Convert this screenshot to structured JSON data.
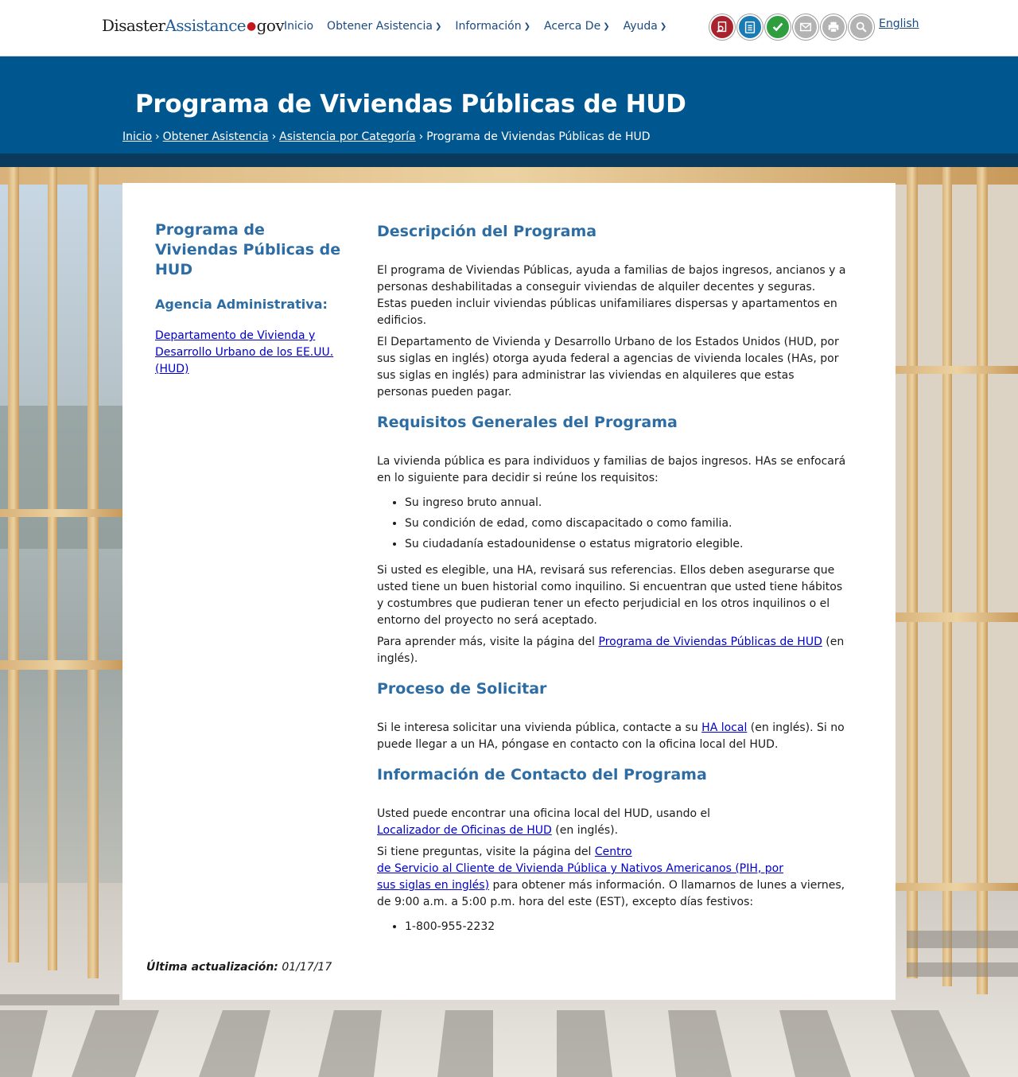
{
  "header": {
    "logo": {
      "part1": "Disaster",
      "part2": "Assistance",
      "dot": "●",
      "part3": "gov"
    },
    "nav": [
      {
        "label": "Inicio",
        "has_dropdown": false
      },
      {
        "label": "Obtener Asistencia",
        "has_dropdown": true
      },
      {
        "label": "Información",
        "has_dropdown": true
      },
      {
        "label": "Acerca De",
        "has_dropdown": true
      },
      {
        "label": "Ayuda",
        "has_dropdown": true
      }
    ],
    "tools": [
      {
        "icon": "search-document-icon",
        "color": "#a8232e"
      },
      {
        "icon": "checklist-icon",
        "color": "#1a7bb5"
      },
      {
        "icon": "checkmark-icon",
        "color": "#2e9e3f"
      },
      {
        "icon": "email-icon",
        "color": "#b3b3b3"
      },
      {
        "icon": "print-icon",
        "color": "#b3b3b3"
      },
      {
        "icon": "magnifier-icon",
        "color": "#b3b3b3"
      }
    ],
    "language_link": "English"
  },
  "hero": {
    "title": "Programa de Viviendas Públicas de HUD",
    "breadcrumb": {
      "items": [
        "Inicio",
        "Obtener Asistencia",
        "Asistencia por Categoría"
      ],
      "current": "Programa de Viviendas Públicas de HUD",
      "separator": "›"
    }
  },
  "sidebar": {
    "title": "Programa de Viviendas Públicas de HUD",
    "agency_heading": "Agencia Administrativa:",
    "agency_link": "Departamento de Vivienda y Desarrollo Urbano de los EE.UU. (HUD)"
  },
  "main": {
    "description": {
      "heading": "Descripción del Programa",
      "p1": "El programa de Viviendas Públicas, ayuda a familias de bajos ingresos, ancianos y a personas deshabilitadas a conseguir viviendas de alquiler decentes y seguras. Estas pueden incluir viviendas públicas unifamiliares dispersas y apartamentos en edificios.",
      "p2": "El Departamento de Vivienda y Desarrollo Urbano de los Estados Unidos (HUD, por sus siglas en inglés) otorga ayuda federal a agencias de vivienda locales (HAs, por sus siglas en inglés) para administrar las viviendas en alquileres que estas personas pueden pagar."
    },
    "requirements": {
      "heading": "Requisitos Generales del Programa",
      "intro": "La vivienda pública es para individuos y familias de bajos ingresos. HAs se enfocará en lo siguiente para decidir si reúne los requisitos:",
      "items": [
        "Su ingreso bruto annual.",
        "Su condición de edad, como discapacitado o como familia.",
        "Su ciudadanía estadounidense o estatus migratorio elegible."
      ],
      "p2": "Si usted es elegible, una HA, revisará sus referencias. Ellos deben asegurarse que usted tiene un buen historial como inquilino. Si encuentran que usted tiene hábitos y costumbres que pudieran tener un efecto perjudicial en los otros inquilinos o el entorno del proyecto no será aceptado.",
      "more_before": "Para aprender más, visite la página del ",
      "more_link": "Programa de Viviendas Públicas de HUD",
      "more_after": " (en inglés)."
    },
    "apply": {
      "heading": "Proceso de Solicitar",
      "before": "Si le interesa solicitar una vivienda pública, contacte a su ",
      "link": "HA local",
      "after": " (en inglés). Si no puede llegar a un HA, póngase en contacto con la oficina local del HUD."
    },
    "contact": {
      "heading": "Información de Contacto del Programa",
      "p1_before": "Usted puede encontrar una oficina local del HUD, usando el",
      "p1_link": "Localizador de Oficinas de HUD",
      "p1_after": " (en inglés).",
      "p2_before": "Si tiene preguntas, visite la página del ",
      "p2_link_a": "Centro",
      "p2_link_b": "de Servicio al Cliente de Vivienda Pública y Nativos Americanos (PIH, por",
      "p2_link_c": "sus siglas en inglés)",
      "p2_after": " para obtener más información. O llamarnos de lunes a viernes, de 9:00 a.m. a 5:00 p.m. hora del este (EST), excepto días festivos:",
      "phones": [
        "1-800-955-2232"
      ]
    }
  },
  "footer": {
    "updated_label": "Última actualización:",
    "updated_date": "01/17/17"
  },
  "colors": {
    "hero_blue": "#00578f",
    "heading_blue": "#2e6da4",
    "link_blue": "#0000cc",
    "nav_blue": "#1a4a80"
  }
}
